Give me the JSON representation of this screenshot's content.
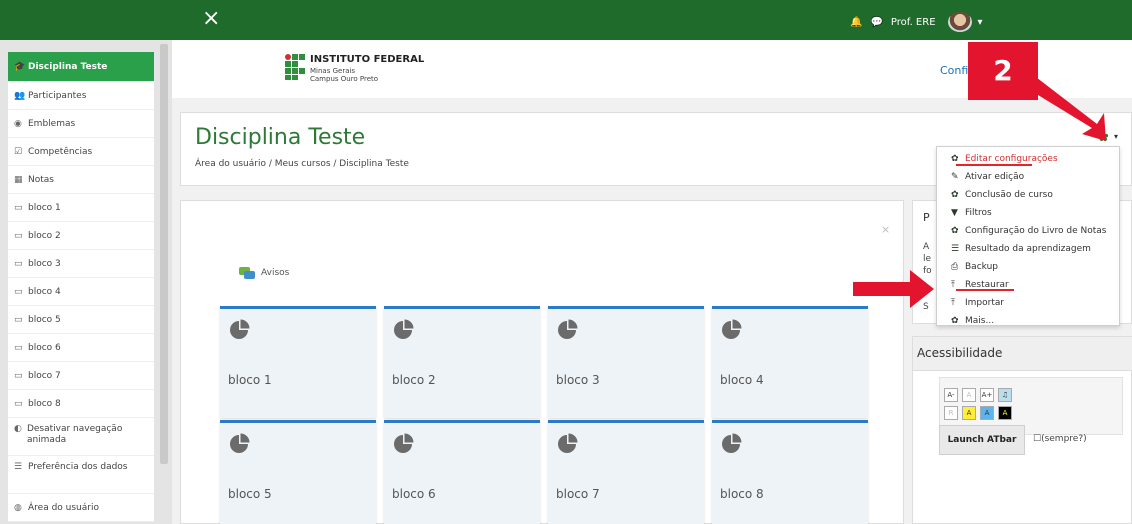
{
  "topbar": {
    "close_icon": "×",
    "user_name": "Prof. ERE",
    "bell_icon": "bell-icon",
    "chat_icon": "chat-icon"
  },
  "nav": {
    "items": [
      {
        "label": "Disciplina Teste",
        "icon": "🎓"
      },
      {
        "label": "Participantes",
        "icon": "👥"
      },
      {
        "label": "Emblemas",
        "icon": "◉"
      },
      {
        "label": "Competências",
        "icon": "☑"
      },
      {
        "label": "Notas",
        "icon": "▦"
      },
      {
        "label": "bloco 1",
        "icon": "▭"
      },
      {
        "label": "bloco 2",
        "icon": "▭"
      },
      {
        "label": "bloco 3",
        "icon": "▭"
      },
      {
        "label": "bloco 4",
        "icon": "▭"
      },
      {
        "label": "bloco 5",
        "icon": "▭"
      },
      {
        "label": "bloco 6",
        "icon": "▭"
      },
      {
        "label": "bloco 7",
        "icon": "▭"
      },
      {
        "label": "bloco 8",
        "icon": "▭"
      },
      {
        "label": "Desativar navegação animada",
        "icon": "◐"
      },
      {
        "label": "Preferência dos dados",
        "icon": "☰"
      },
      {
        "label": "Área do usuário",
        "icon": "◍"
      }
    ]
  },
  "logo": {
    "line1": "INSTITUTO FEDERAL",
    "line2": "Minas Gerais",
    "line3": "Campus Ouro Preto"
  },
  "header": {
    "config_link": "Confi",
    "course_title": "Disciplina Teste",
    "breadcrumb": "Área do usuário  /  Meus cursos  /  Disciplina Teste"
  },
  "main": {
    "close": "×",
    "avisos": "Avisos",
    "tiles": [
      "bloco 1",
      "bloco 2",
      "bloco 3",
      "bloco 4",
      "bloco 5",
      "bloco 6",
      "bloco 7",
      "bloco 8"
    ]
  },
  "menu": {
    "items": [
      {
        "label": "Editar configurações",
        "icon": "✿"
      },
      {
        "label": "Ativar edição",
        "icon": "✎"
      },
      {
        "label": "Conclusão de curso",
        "icon": "✿"
      },
      {
        "label": "Filtros",
        "icon": "▼"
      },
      {
        "label": "Configuração do Livro de Notas",
        "icon": "✿"
      },
      {
        "label": "Resultado da aprendizagem",
        "icon": "☰"
      },
      {
        "label": "Backup",
        "icon": "⎙"
      },
      {
        "label": "Restaurar",
        "icon": "⤒"
      },
      {
        "label": "Importar",
        "icon": "⤒"
      },
      {
        "label": "Mais...",
        "icon": "✿"
      }
    ]
  },
  "right_block": {
    "header": "P",
    "text_lines": [
      "A",
      "le",
      "fo",
      "",
      "S"
    ]
  },
  "accessibility": {
    "header": "Acessibilidade",
    "buttons_row1": [
      "A-",
      "A",
      "A+",
      "♫"
    ],
    "buttons_row2": [
      "R",
      "A",
      "A",
      "A"
    ],
    "launch": "Launch ATbar",
    "sempre": "☐(sempre?)"
  },
  "callout": {
    "number": "2"
  },
  "colors": {
    "topbar": "#1e6b2b",
    "accent_green": "#2aa04a",
    "highlight_red": "#e3142e",
    "tile_border": "#2a7ac8"
  }
}
